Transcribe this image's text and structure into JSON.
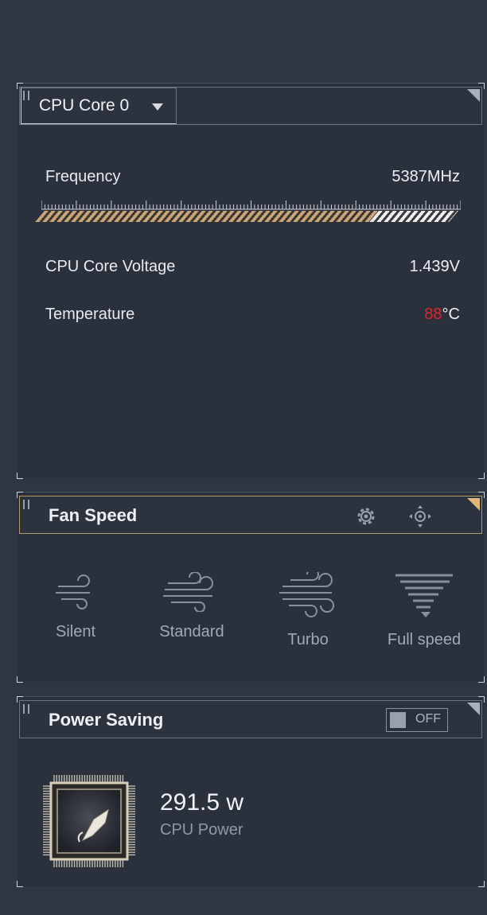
{
  "cpu": {
    "selected_core": "CPU Core 0",
    "frequency": {
      "label": "Frequency",
      "value": "5387MHz",
      "fill_fraction": 1.0
    },
    "voltage": {
      "label": "CPU Core Voltage",
      "value": "1.439V"
    },
    "temperature": {
      "label": "Temperature",
      "value": "88",
      "unit": "°C",
      "value_color": "#e0252a"
    }
  },
  "fan": {
    "title": "Fan Speed",
    "modes": [
      {
        "label": "Silent",
        "icon": "wind-light-icon"
      },
      {
        "label": "Standard",
        "icon": "wind-medium-icon"
      },
      {
        "label": "Turbo",
        "icon": "wind-strong-icon"
      },
      {
        "label": "Full speed",
        "icon": "tornado-icon"
      }
    ],
    "header_icons": [
      "gear-icon",
      "move-icon"
    ]
  },
  "power": {
    "title": "Power Saving",
    "toggle_label": "OFF",
    "toggle_on": false,
    "value": "291.5 w",
    "label": "CPU Power",
    "icon": "cpu-chip-icon"
  },
  "colors": {
    "accent_gold": "#e0b57a",
    "background": "#2f3541",
    "alert_red": "#e0252a"
  }
}
